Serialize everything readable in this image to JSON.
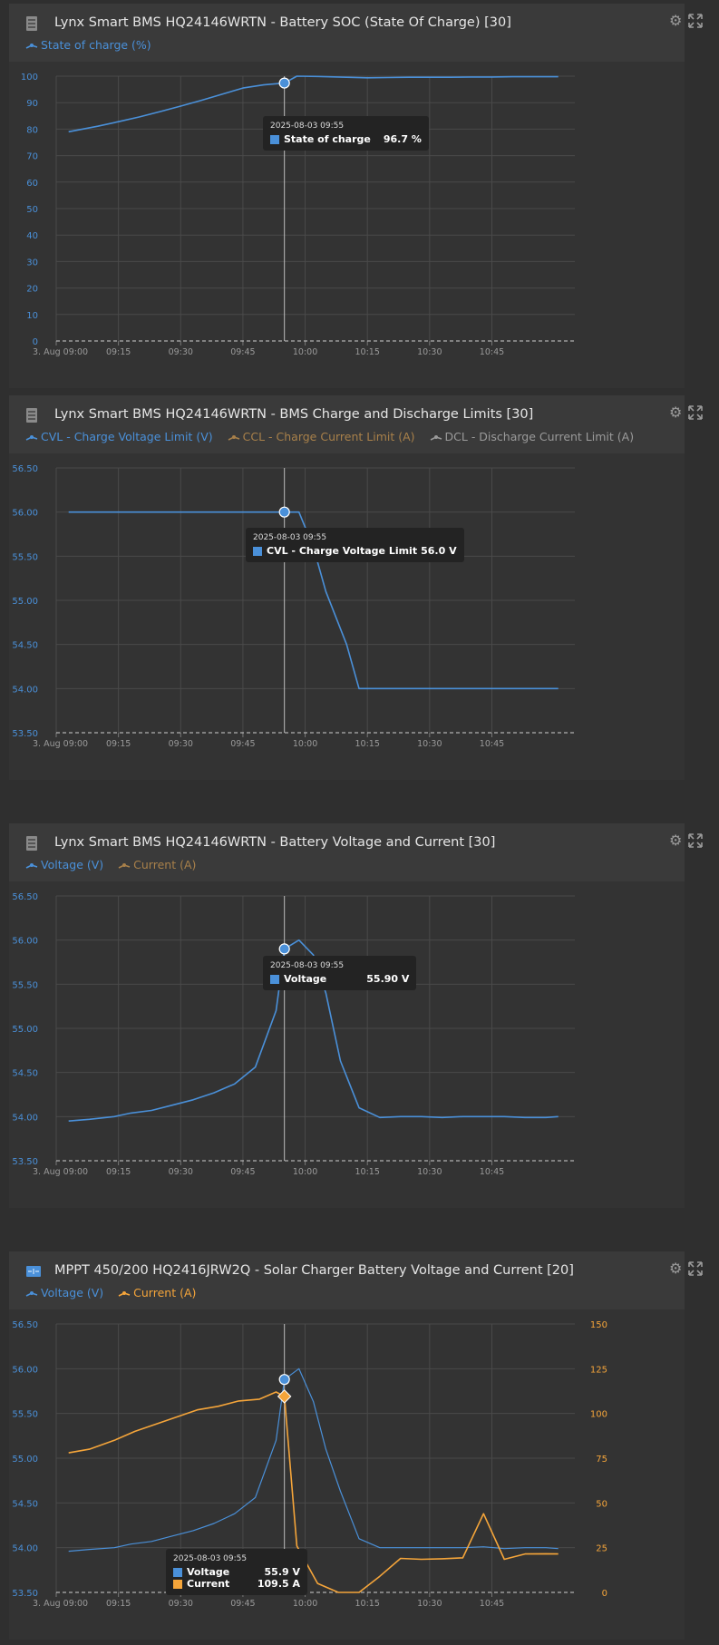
{
  "panels": [
    {
      "title": "Lynx Smart BMS HQ24146WRTN - Battery SOC (State Of Charge) [30]",
      "icon": "battery-monitor-icon",
      "legend": [
        {
          "label": "State of charge (%)",
          "color": "#4a90d9"
        }
      ],
      "tooltip": {
        "time": "2025-08-03 09:55",
        "rows": [
          {
            "label": "State of charge",
            "value": "96.7 %",
            "color": "#4a90d9"
          }
        ]
      }
    },
    {
      "title": "Lynx Smart BMS HQ24146WRTN - BMS Charge and Discharge Limits [30]",
      "icon": "battery-monitor-icon",
      "legend": [
        {
          "label": "CVL - Charge Voltage Limit (V)",
          "color": "#4a90d9"
        },
        {
          "label": "CCL - Charge Current Limit (A)",
          "color": "#a8804a"
        },
        {
          "label": "DCL - Discharge Current Limit (A)",
          "color": "#9a9a9a"
        }
      ],
      "tooltip": {
        "time": "2025-08-03 09:55",
        "rows": [
          {
            "label": "CVL - Charge Voltage Limit",
            "value": "56.0 V",
            "color": "#4a90d9"
          }
        ]
      }
    },
    {
      "title": "Lynx Smart BMS HQ24146WRTN - Battery Voltage and Current [30]",
      "icon": "battery-monitor-icon",
      "legend": [
        {
          "label": "Voltage (V)",
          "color": "#4a90d9"
        },
        {
          "label": "Current (A)",
          "color": "#a8804a"
        }
      ],
      "tooltip": {
        "time": "2025-08-03 09:55",
        "rows": [
          {
            "label": "Voltage",
            "value": "55.90 V",
            "color": "#4a90d9"
          }
        ]
      }
    },
    {
      "title": "MPPT 450/200 HQ2416JRW2Q - Solar Charger Battery Voltage and Current [20]",
      "icon": "solar-charger-icon",
      "legend": [
        {
          "label": "Voltage (V)",
          "color": "#4a90d9"
        },
        {
          "label": "Current (A)",
          "color": "#f5a53a"
        }
      ],
      "tooltip": {
        "time": "2025-08-03 09:55",
        "rows": [
          {
            "label": "Voltage",
            "value": "55.9 V",
            "color": "#4a90d9"
          },
          {
            "label": "Current",
            "value": "109.5 A",
            "color": "#f5a53a"
          }
        ]
      }
    }
  ],
  "chart_data": [
    {
      "type": "line",
      "x_ticks": [
        "3. Aug 09:00",
        "09:15",
        "09:30",
        "09:45",
        "10:00",
        "10:15",
        "10:30",
        "10:45"
      ],
      "ylim": [
        0,
        100
      ],
      "y_ticks": [
        "0",
        "10",
        "20",
        "30",
        "40",
        "50",
        "60",
        "70",
        "80",
        "90",
        "100"
      ],
      "hover_minute": 55,
      "series": [
        {
          "name": "State of charge (%)",
          "color": "#4a90d9",
          "x": [
            3,
            10,
            15,
            20,
            25,
            30,
            35,
            40,
            45,
            50,
            55,
            58,
            63,
            70,
            75,
            80,
            85,
            90,
            95,
            100,
            105,
            110,
            115,
            121
          ],
          "y": [
            79,
            81.1,
            82.8,
            84.6,
            86.6,
            88.7,
            90.9,
            93.2,
            95.5,
            96.7,
            97.4,
            100,
            99.9,
            99.6,
            99.4,
            99.5,
            99.6,
            99.6,
            99.6,
            99.7,
            99.7,
            99.8,
            99.8,
            99.8
          ]
        }
      ]
    },
    {
      "type": "line",
      "x_ticks": [
        "3. Aug 09:00",
        "09:15",
        "09:30",
        "09:45",
        "10:00",
        "10:15",
        "10:30",
        "10:45"
      ],
      "ylim": [
        53.5,
        56.5
      ],
      "y_ticks": [
        "53.50",
        "54.00",
        "54.50",
        "55.00",
        "55.50",
        "56.00",
        "56.50"
      ],
      "hover_minute": 55,
      "series": [
        {
          "name": "CVL - Charge Voltage Limit (V)",
          "color": "#4a90d9",
          "x": [
            3,
            10,
            20,
            30,
            40,
            50,
            55,
            58.5,
            62,
            65,
            70,
            73,
            80,
            90,
            100,
            110,
            121
          ],
          "y": [
            56,
            56,
            56,
            56,
            56,
            56,
            56,
            56,
            55.6,
            55.1,
            54.5,
            54,
            54,
            54,
            54,
            54,
            54
          ]
        }
      ]
    },
    {
      "type": "line",
      "x_ticks": [
        "3. Aug 09:00",
        "09:15",
        "09:30",
        "09:45",
        "10:00",
        "10:15",
        "10:30",
        "10:45"
      ],
      "ylim": [
        53.5,
        56.5
      ],
      "y_ticks": [
        "53.50",
        "54.00",
        "54.50",
        "55.00",
        "55.50",
        "56.00",
        "56.50"
      ],
      "hover_minute": 55,
      "series": [
        {
          "name": "Voltage (V)",
          "color": "#4a90d9",
          "x": [
            3,
            8,
            14,
            18,
            23,
            28,
            33,
            38,
            43,
            48,
            53,
            55,
            58.5,
            62,
            65,
            68.5,
            73,
            78,
            83,
            88,
            93,
            98,
            103,
            108,
            113,
            118,
            121
          ],
          "y": [
            53.95,
            53.97,
            54.0,
            54.04,
            54.07,
            54.13,
            54.19,
            54.27,
            54.37,
            54.56,
            55.2,
            55.9,
            56.0,
            55.83,
            55.4,
            54.63,
            54.1,
            53.99,
            54.0,
            54.0,
            53.99,
            54.0,
            54.0,
            54.0,
            53.99,
            53.99,
            54.0
          ]
        }
      ]
    },
    {
      "type": "line",
      "x_ticks": [
        "3. Aug 09:00",
        "09:15",
        "09:30",
        "09:45",
        "10:00",
        "10:15",
        "10:30",
        "10:45"
      ],
      "ylim": [
        53.5,
        56.5
      ],
      "y_ticks": [
        "53.50",
        "54.00",
        "54.50",
        "55.00",
        "55.50",
        "56.00",
        "56.50"
      ],
      "y2lim": [
        0,
        150
      ],
      "y2_ticks": [
        "0",
        "25",
        "50",
        "75",
        "100",
        "125",
        "150"
      ],
      "hover_minute": 55,
      "series": [
        {
          "name": "Voltage (V)",
          "color": "#4a90d9",
          "axis": "left",
          "x": [
            3,
            8,
            14,
            18,
            23,
            28,
            33,
            38,
            43,
            48,
            53,
            55,
            58.5,
            62,
            65,
            68.5,
            73,
            78,
            83,
            88,
            93,
            98,
            103,
            108,
            113,
            118,
            121
          ],
          "y": [
            53.96,
            53.98,
            54.0,
            54.04,
            54.07,
            54.13,
            54.19,
            54.27,
            54.38,
            54.56,
            55.2,
            55.88,
            56.0,
            55.63,
            55.1,
            54.63,
            54.1,
            54.0,
            54.0,
            54.0,
            54.0,
            54.0,
            54.01,
            53.99,
            54.0,
            54.0,
            53.99
          ]
        },
        {
          "name": "Current (A)",
          "color": "#f5a53a",
          "axis": "right",
          "x": [
            3,
            8,
            14,
            19,
            24,
            29,
            34,
            39,
            44,
            49,
            53,
            55,
            58,
            63,
            68,
            73,
            78,
            83,
            88,
            93,
            98,
            103,
            108,
            113,
            118,
            121
          ],
          "y": [
            78,
            80,
            85,
            90,
            94,
            98,
            102,
            104,
            107,
            108,
            112,
            109.5,
            26,
            5,
            0,
            0,
            9,
            19,
            18.5,
            18.8,
            19.3,
            44,
            18.5,
            21.5,
            21.6,
            21.5
          ]
        }
      ]
    }
  ]
}
